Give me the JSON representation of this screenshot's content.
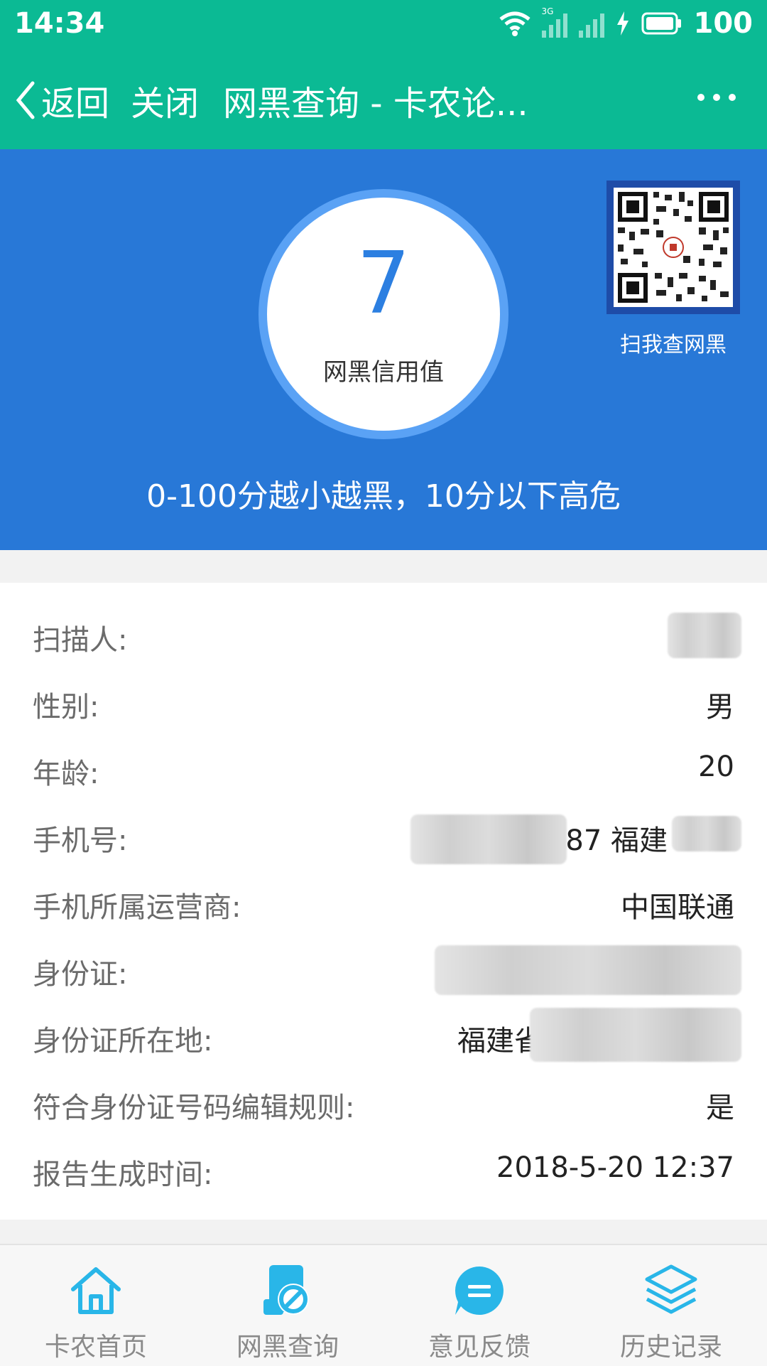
{
  "status_bar": {
    "time": "14:34",
    "network_label": "3G",
    "battery": "100"
  },
  "title_bar": {
    "back_label": "返回",
    "close_label": "关闭",
    "title": "网黑查询 - 卡农论..."
  },
  "hero": {
    "score": "7",
    "score_label": "网黑信用值",
    "qr_caption": "扫我查网黑",
    "note": "0-100分越小越黑，10分以下高危"
  },
  "info": {
    "rows": [
      {
        "label": "扫描人:",
        "value": ""
      },
      {
        "label": "性别:",
        "value": "男"
      },
      {
        "label": "年龄:",
        "value": "20"
      },
      {
        "label": "手机号:",
        "value": "87 福建"
      },
      {
        "label": "手机所属运营商:",
        "value": "中国联通"
      },
      {
        "label": "身份证:",
        "value": ""
      },
      {
        "label": "身份证所在地:",
        "value": "福建省"
      },
      {
        "label": "符合身份证号码编辑规则:",
        "value": "是"
      },
      {
        "label": "报告生成时间:",
        "value": "2018-5-20 12:37"
      }
    ]
  },
  "tabs": [
    {
      "label": "卡农首页",
      "icon": "home-icon"
    },
    {
      "label": "网黑查询",
      "icon": "blacklist-query-icon"
    },
    {
      "label": "意见反馈",
      "icon": "feedback-icon"
    },
    {
      "label": "历史记录",
      "icon": "history-layers-icon"
    }
  ],
  "colors": {
    "header_green": "#0bba94",
    "hero_blue": "#2878d7",
    "score_blue": "#2c7fe1",
    "tab_icon": "#29b6e8"
  }
}
